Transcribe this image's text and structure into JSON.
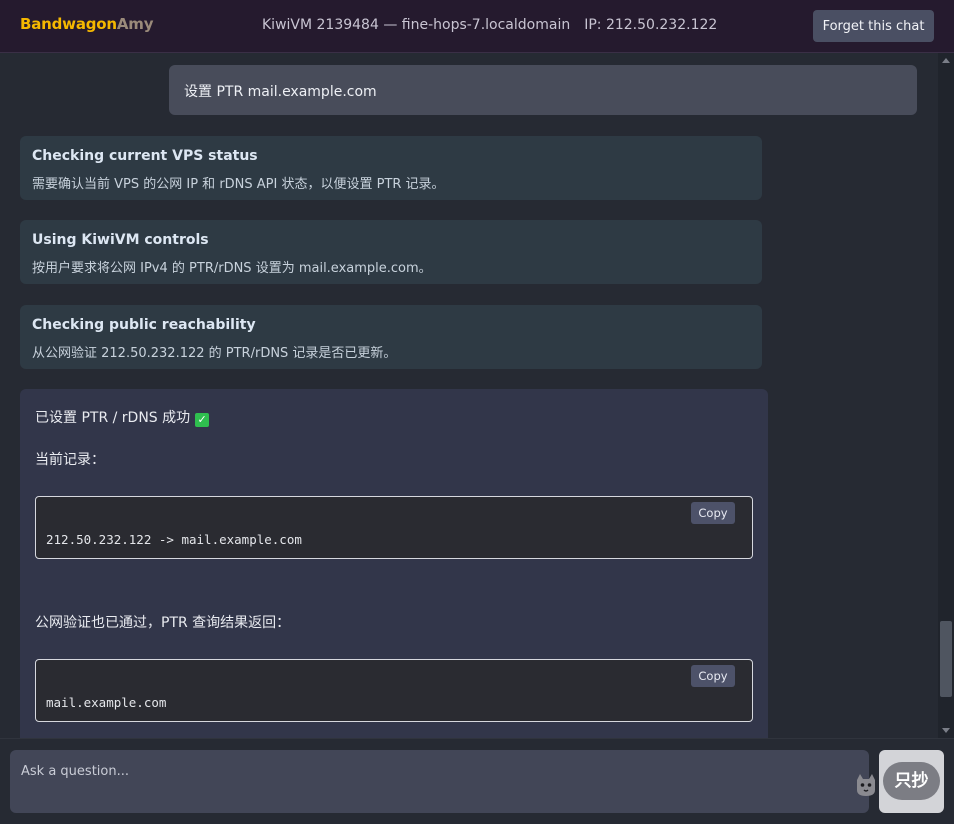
{
  "header": {
    "logo_part1": "Bandwagon",
    "logo_part2": "Amy",
    "vm_info": "KiwiVM 2139484 — fine-hops-7.localdomain",
    "ip_info": "IP: 212.50.232.122",
    "forget_button": "Forget this chat"
  },
  "chat": {
    "user_message": "设置 PTR mail.example.com",
    "steps": [
      {
        "title": "Checking current VPS status",
        "detail": "需要确认当前 VPS 的公网 IP 和 rDNS API 状态，以便设置 PTR 记录。"
      },
      {
        "title": "Using KiwiVM controls",
        "detail": "按用户要求将公网 IPv4 的 PTR/rDNS 设置为 mail.example.com。"
      },
      {
        "title": "Checking public reachability",
        "detail": "从公网验证 212.50.232.122 的 PTR/rDNS 记录是否已更新。"
      }
    ],
    "answer": {
      "heading": "已设置 PTR / rDNS 成功",
      "check_glyph": "✓",
      "current_record_label": "当前记录：",
      "code1": "212.50.232.122 -> mail.example.com",
      "verify_label": "公网验证也已通过，PTR 查询结果返回：",
      "code2": "mail.example.com",
      "copy_label": "Copy"
    }
  },
  "input": {
    "placeholder": "Ask a question...",
    "send_badge": "只抄"
  },
  "colors": {
    "accent_logo": "#f5b800",
    "header_bg": "#251a2e",
    "page_bg": "#262a33",
    "step_bg": "#2e3a44",
    "answer_bg": "#32364a",
    "check_green": "#2fbf4f"
  },
  "icons": {
    "status_check": "check-box-icon",
    "watermark": "cat-icon"
  }
}
